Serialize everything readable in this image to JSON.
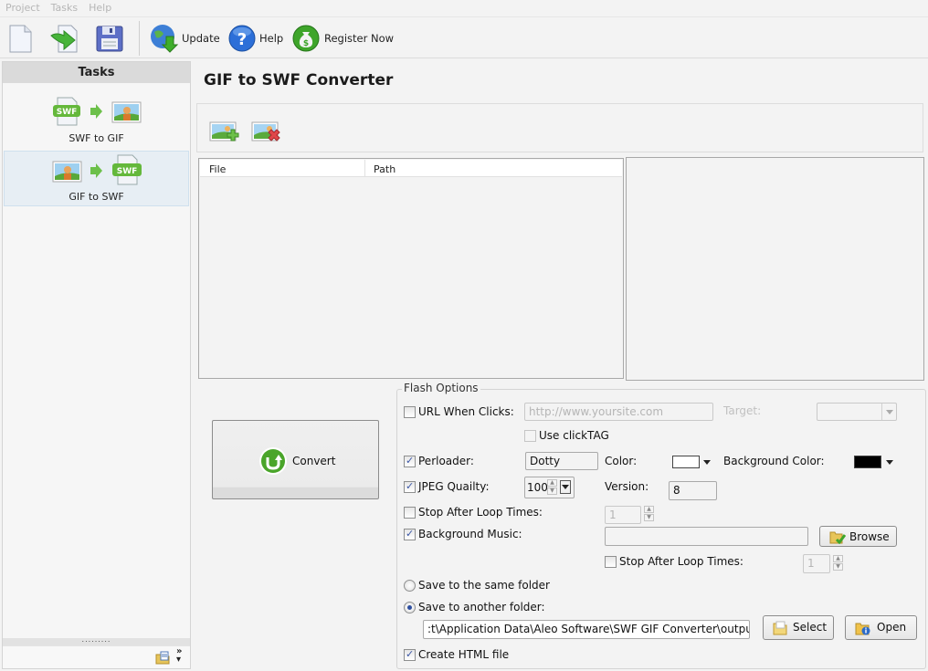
{
  "menu": [
    "Project",
    "Tasks",
    "Help"
  ],
  "toolbar": {
    "icons": [
      "new-file-icon",
      "open-export-icon",
      "save-icon"
    ],
    "update_label": "Update",
    "help_label": "Help",
    "register_label": "Register Now"
  },
  "sidebar": {
    "header": "Tasks",
    "items": [
      {
        "label": "SWF to GIF",
        "active": false
      },
      {
        "label": "GIF to SWF",
        "active": true
      }
    ],
    "grip": "........."
  },
  "main": {
    "title": "GIF to SWF Converter",
    "file_toolbar": {
      "add_icon": "add-image-icon",
      "remove_icon": "remove-image-icon"
    },
    "table": {
      "columns": [
        "File",
        "Path"
      ],
      "rows": []
    },
    "convert_label": "Convert"
  },
  "flash_options": {
    "legend": "Flash Options",
    "url_when_clicks": {
      "label": "URL When Clicks:",
      "checked": false,
      "placeholder": "http://www.yoursite.com"
    },
    "target": {
      "label": "Target:",
      "value": ""
    },
    "use_clicktag": {
      "label": "Use clickTAG",
      "checked": false
    },
    "preloader": {
      "label": "Perloader:",
      "checked": true,
      "value": "Dotty"
    },
    "color": {
      "label": "Color:",
      "value": "#ffffff"
    },
    "background_color": {
      "label": "Background Color:",
      "value": "#000000"
    },
    "jpeg_quality": {
      "label": "JPEG Quailty:",
      "checked": true,
      "value": "100"
    },
    "version": {
      "label": "Version:",
      "value": "8"
    },
    "stop_after_loop": {
      "label": "Stop After Loop Times:",
      "checked": false,
      "value": "1"
    },
    "background_music": {
      "label": "Background Music:",
      "checked": true,
      "value": "",
      "browse_label": "Browse"
    },
    "music_stop_after_loop": {
      "label": "Stop After Loop Times:",
      "checked": false,
      "value": "1"
    },
    "save_same": {
      "label": "Save to the same folder",
      "selected": false
    },
    "save_another": {
      "label": "Save to another folder:",
      "selected": true
    },
    "output_path": ":t\\Application Data\\Aleo Software\\SWF GIF Converter\\output\\",
    "select_label": "Select",
    "open_label": "Open",
    "create_html": {
      "label": "Create HTML file",
      "checked": true
    }
  }
}
